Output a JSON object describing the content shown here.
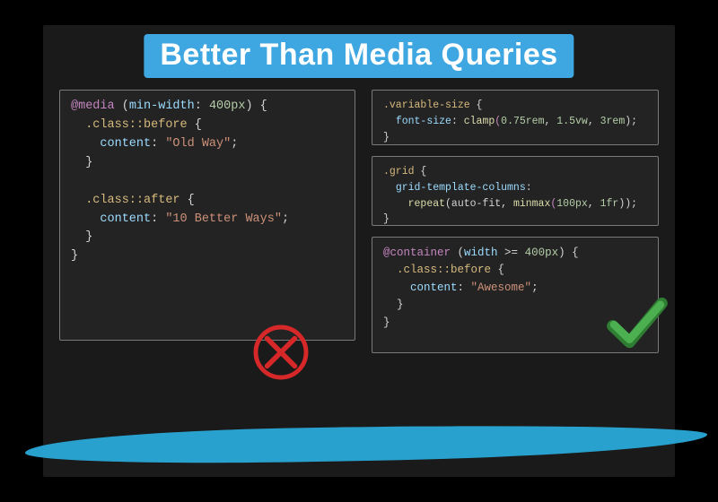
{
  "title": "Better Than Media Queries",
  "left_box": {
    "l1a": "@media",
    "l1b": " (",
    "l1c": "min-width",
    "l1d": ": ",
    "l1e": "400px",
    "l1f": ") {",
    "l2a": "  ",
    "l2b": ".class::before",
    "l2c": " {",
    "l3a": "    ",
    "l3b": "content",
    "l3c": ": ",
    "l3d": "\"Old Way\"",
    "l3e": ";",
    "l4": "  }",
    "l5": "",
    "l6a": "  ",
    "l6b": ".class::after",
    "l6c": " {",
    "l7a": "    ",
    "l7b": "content",
    "l7c": ": ",
    "l7d": "\"10 Better Ways\"",
    "l7e": ";",
    "l8": "  }",
    "l9": "}"
  },
  "r1": {
    "l1a": ".variable-size",
    "l1b": " {",
    "l2a": "  ",
    "l2b": "font-size",
    "l2c": ": ",
    "l2d": "clamp",
    "l2e": "(",
    "l2f": "0.75rem",
    "l2g": ", ",
    "l2h": "1.5vw",
    "l2i": ", ",
    "l2j": "3rem",
    "l2k": ");",
    "l3": "}"
  },
  "r2": {
    "l1a": ".grid",
    "l1b": " {",
    "l2a": "  ",
    "l2b": "grid-template-columns",
    "l2c": ":",
    "l3a": "    ",
    "l3b": "repeat",
    "l3c": "(auto-fit, ",
    "l3d": "minmax",
    "l3e": "(",
    "l3f": "100px",
    "l3g": ", ",
    "l3h": "1fr",
    "l3i": "));",
    "l4": "}"
  },
  "r3": {
    "l1a": "@container",
    "l1b": " (",
    "l1c": "width",
    "l1d": " >= ",
    "l1e": "400px",
    "l1f": ") {",
    "l2a": "  ",
    "l2b": ".class::before",
    "l2c": " {",
    "l3a": "    ",
    "l3b": "content",
    "l3c": ": ",
    "l3d": "\"Awesome\"",
    "l3e": ";",
    "l4": "  }",
    "l5": "}"
  },
  "marks": {
    "x": "cross-out-icon",
    "check": "checkmark-icon"
  }
}
